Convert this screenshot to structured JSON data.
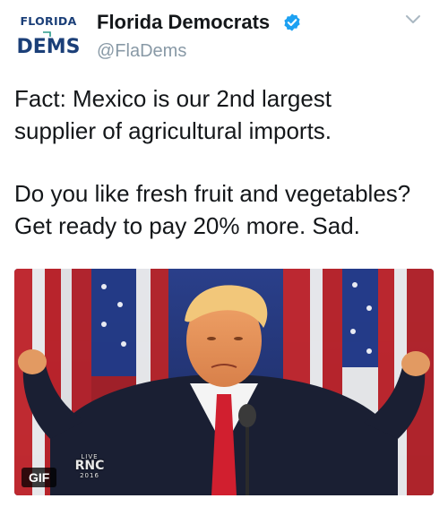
{
  "account": {
    "logo_line1": "FLORIDA",
    "logo_line2": "DEMS",
    "display_name": "Florida Democrats",
    "handle": "@FlaDems",
    "verified": true
  },
  "tweet": {
    "paragraph1": [
      "Fact: Mexico is our 2nd largest",
      "supplier of agricultural imports."
    ],
    "paragraph2": [
      "Do you like fresh fruit and vegetables?",
      "Get ready to pay 20% more. Sad."
    ]
  },
  "media": {
    "badge": "GIF",
    "overlay_live": "LIVE",
    "overlay_event": "RNC",
    "overlay_year": "2016"
  },
  "icons": {
    "verified": "verified-badge-icon",
    "menu": "chevron-down-icon"
  },
  "colors": {
    "brand_navy": "#1b3f78",
    "verified_blue": "#1da1f2",
    "handle_gray": "#8899a6",
    "text": "#14171a"
  }
}
